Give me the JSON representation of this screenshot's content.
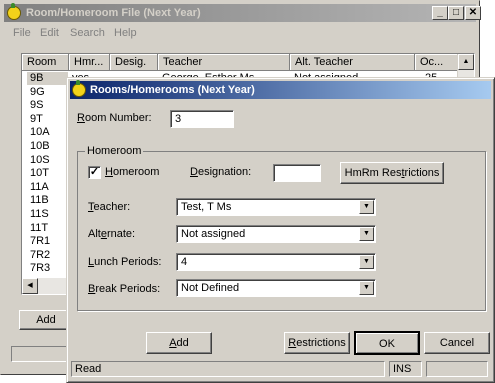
{
  "back_window": {
    "title": "Room/Homeroom File (Next Year)",
    "menu": [
      "File",
      "Edit",
      "Search",
      "Help"
    ],
    "columns": [
      "Room",
      "Hmr...",
      "Desig.",
      "Teacher",
      "Alt. Teacher",
      "Oc..."
    ],
    "first_row": {
      "homeroom": "yes",
      "teacher": "George, Esther Ms",
      "alt_teacher": "Not assigned",
      "occupancy": "25"
    },
    "rooms": [
      "9B",
      "9G",
      "9S",
      "9T",
      "10A",
      "10B",
      "10S",
      "10T",
      "11A",
      "11B",
      "11S",
      "11T",
      "7R1",
      "7R2",
      "7R3"
    ],
    "add_label": "Add"
  },
  "dialog": {
    "title": "Rooms/Homerooms  (Next Year)",
    "room_number_label": "Room Number:",
    "room_number_value": "3",
    "group_label": "Homeroom",
    "homeroom_checkbox_label": "Homeroom",
    "homeroom_checked": true,
    "designation_label": "Designation:",
    "designation_value": "",
    "hmrm_restrictions_label": "HmRm Restrictions",
    "teacher_label": "Teacher:",
    "teacher_value": "Test, T  Ms",
    "alternate_label": "Alternate:",
    "alternate_value": "Not assigned",
    "lunch_label": "Lunch Periods:",
    "lunch_value": "4",
    "break_label": "Break Periods:",
    "break_value": "Not Defined",
    "add_button": "Add",
    "restrictions_button": "Restrictions",
    "ok_button": "OK",
    "cancel_button": "Cancel",
    "status_text": "Read",
    "status_mode": "INS"
  }
}
